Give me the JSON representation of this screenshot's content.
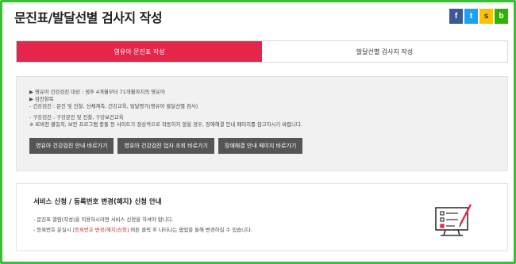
{
  "page": {
    "title": "문진표/발달선별 검사지 작성"
  },
  "share": {
    "facebook_glyph": "f",
    "twitter_glyph": "t",
    "kakaostory_glyph": "s",
    "band_glyph": "b"
  },
  "tabs": [
    {
      "label": "영유아 문진표 작성",
      "active": true
    },
    {
      "label": "발달선별 검사지 작성",
      "active": false
    }
  ],
  "info": {
    "lines": [
      "▶ 영유아 건강검진 대상 : 생후 4개월부터 71개월까지의 영유아",
      "▶ 검진항목",
      "- 건강검진 : 문진 및 진찰, 신체계측, 건강교육, 발달평가(영유아 발달선별 검사)",
      "- 구강검진 : 구강문진 및 진찰, 구강보건교육",
      "※ IE버전 불일치, 보안 프로그램 충돌 등 사이트가 정상적으로 작동하지 않을 경우, 장애해결 안내 페이지를 참고하시기 바랍니다."
    ],
    "buttons": [
      "영유아 건강검진 안내 바로가기",
      "영유아 건강검진 업자 조회 바로가기",
      "장애해결 안내 페이지 바로가기"
    ]
  },
  "service": {
    "title": "서비스 신청 / 등록번호 변경(해지) 신청 안내",
    "line1": "- 문진표 열람(작성)을 이용하시려면 서비스 신청을 하셔야 합니다.",
    "line2_pre": "- 등록번호 분실시 ",
    "line2_highlight": "[등록번호 변경(해지)신청]",
    "line2_post": " 버튼 클릭 후 나타나는 팝업을 통해 변경하실 수 있습니다."
  },
  "colors": {
    "accent": "#e4264b",
    "frame": "#36c230",
    "button_bg": "#555555",
    "highlight": "#c9322b"
  }
}
